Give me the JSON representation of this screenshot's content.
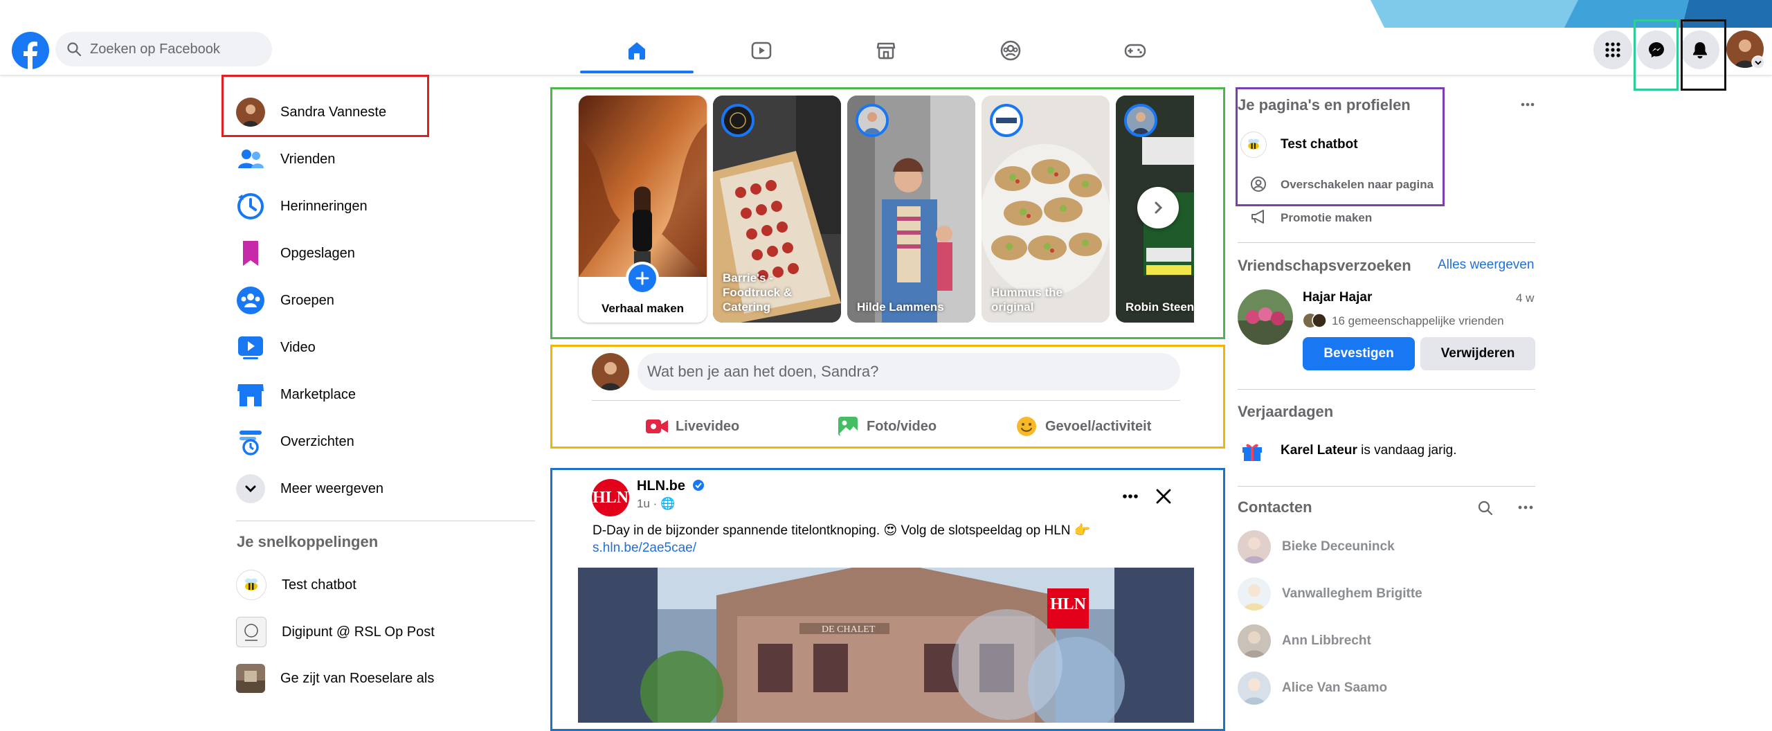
{
  "colors": {
    "fb_blue": "#1877f2",
    "annotation_red": "#e02020",
    "annotation_green": "#4bb84b",
    "annotation_orange": "#f5b400",
    "annotation_blue": "#1a73c8",
    "annotation_purple": "#7b3fb3",
    "annotation_teal": "#2ecc9a",
    "annotation_black": "#111111"
  },
  "header": {
    "logo_icon": "facebook-logo-icon",
    "search_placeholder": "Zoeken op Facebook",
    "nav_tabs": [
      {
        "icon": "home-icon",
        "active": true
      },
      {
        "icon": "video-icon",
        "active": false
      },
      {
        "icon": "marketplace-icon",
        "active": false
      },
      {
        "icon": "groups-icon",
        "active": false
      },
      {
        "icon": "gaming-icon",
        "active": false
      }
    ],
    "right_buttons": [
      "menu-grid-icon",
      "messenger-icon",
      "notifications-bell-icon",
      "account-avatar"
    ]
  },
  "sidebar": {
    "profile_name": "Sandra Vanneste",
    "items": [
      {
        "label": "Vrienden",
        "icon": "friends-icon"
      },
      {
        "label": "Herinneringen",
        "icon": "memories-clock-icon"
      },
      {
        "label": "Opgeslagen",
        "icon": "saved-bookmark-icon"
      },
      {
        "label": "Groepen",
        "icon": "groups-icon"
      },
      {
        "label": "Video",
        "icon": "video-icon"
      },
      {
        "label": "Marketplace",
        "icon": "marketplace-icon"
      },
      {
        "label": "Overzichten",
        "icon": "feeds-icon"
      },
      {
        "label": "Meer weergeven",
        "icon": "chevron-down-icon"
      }
    ],
    "shortcuts_heading": "Je snelkoppelingen",
    "shortcuts": [
      {
        "label": "Test chatbot"
      },
      {
        "label": "Digipunt @ RSL Op Post"
      },
      {
        "label": "Ge zijt van Roeselare als"
      }
    ]
  },
  "stories": {
    "create_label": "Verhaal maken",
    "items": [
      {
        "name": "Barrie's - Foodtruck & Catering"
      },
      {
        "name": "Hilde Lammens"
      },
      {
        "name": "Hummus the original"
      },
      {
        "name": "Robin Steen"
      }
    ]
  },
  "composer": {
    "placeholder": "Wat ben je aan het doen, Sandra?",
    "actions": [
      {
        "label": "Livevideo",
        "icon": "live-video-icon"
      },
      {
        "label": "Foto/video",
        "icon": "photo-icon"
      },
      {
        "label": "Gevoel/activiteit",
        "icon": "feeling-emoji-icon"
      }
    ]
  },
  "post": {
    "page_logo": "HLN",
    "page_name": "HLN.be",
    "meta": "1u · 🌐",
    "text": "D-Day in de bijzonder spannende titelontknoping. 😍 Volg de slotspeeldag op HLN 👉",
    "link": "s.hln.be/2ae5cae/",
    "image_overlay_logo": "HLN",
    "image_sign": "DE CHALET"
  },
  "right": {
    "pages_heading": "Je pagina's en profielen",
    "page_name": "Test chatbot",
    "switch_label": "Overschakelen naar pagina",
    "promo_label": "Promotie maken",
    "friend_requests_heading": "Vriendschapsverzoeken",
    "see_all": "Alles weergeven",
    "request": {
      "name": "Hajar Hajar",
      "time": "4 w",
      "mutual": "16 gemeenschappelijke vrienden",
      "confirm": "Bevestigen",
      "delete": "Verwijderen"
    },
    "birthdays_heading": "Verjaardagen",
    "birthday_name": "Karel Lateur",
    "birthday_text": " is vandaag jarig.",
    "contacts_heading": "Contacten",
    "contacts": [
      {
        "name": "Bieke Deceuninck"
      },
      {
        "name": "Vanwalleghem Brigitte"
      },
      {
        "name": "Ann Libbrecht"
      },
      {
        "name": "Alice Van Saamo"
      }
    ]
  }
}
